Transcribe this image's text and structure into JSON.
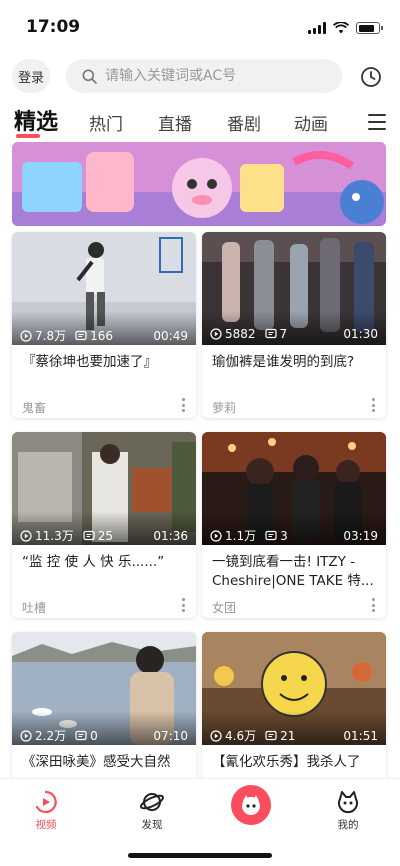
{
  "status_bar": {
    "time": "17:09",
    "battery_level": 0.8
  },
  "header": {
    "login_label": "登录",
    "search_placeholder": "请输入关键词或AC号",
    "history_icon": "clock-icon"
  },
  "tabs": [
    {
      "label": "精选",
      "active": true
    },
    {
      "label": "热门",
      "active": false
    },
    {
      "label": "直播",
      "active": false
    },
    {
      "label": "番剧",
      "active": false
    },
    {
      "label": "动画",
      "active": false
    }
  ],
  "colors": {
    "accent": "#fd4c5c"
  },
  "videos": [
    {
      "views": "7.8万",
      "comments": "166",
      "duration": "00:49",
      "title": "『蔡徐坤也要加速了』",
      "category": "鬼畜"
    },
    {
      "views": "5882",
      "comments": "7",
      "duration": "01:30",
      "title": "瑜伽裤是谁发明的到底?",
      "category": "萝莉"
    },
    {
      "views": "11.3万",
      "comments": "25",
      "duration": "01:36",
      "title": "“监 控 使 人 快 乐......”",
      "category": "吐槽"
    },
    {
      "views": "1.1万",
      "comments": "3",
      "duration": "03:19",
      "title": "一镜到底看一击! ITZY - Cheshire|ONE TAKE 特...",
      "category": "女团"
    },
    {
      "views": "2.2万",
      "comments": "0",
      "duration": "07:10",
      "title": "《深田咏美》感受大自然",
      "category": ""
    },
    {
      "views": "4.6万",
      "comments": "21",
      "duration": "01:51",
      "title": "【氰化欢乐秀】我杀人了",
      "category": ""
    }
  ],
  "bottom_nav": {
    "video_label": "视频",
    "discover_label": "发现",
    "me_label": "我的"
  }
}
